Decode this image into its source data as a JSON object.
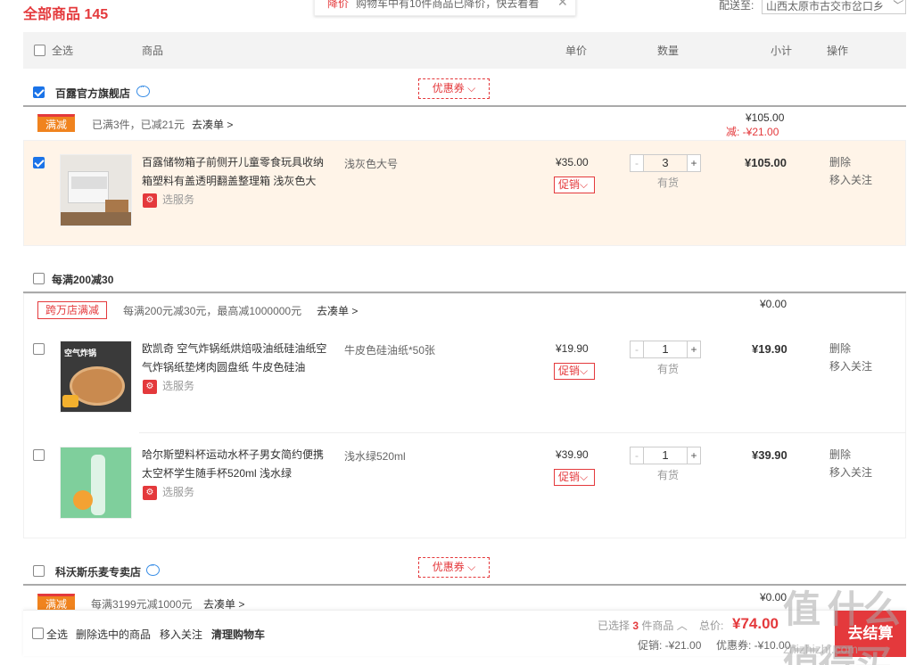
{
  "header": {
    "title": "全部商品",
    "count": "145",
    "toast_tag": "降价",
    "toast_msg": "购物车中有10件商品已降价，快去看看",
    "ship_label": "配送至:",
    "ship_addr": "山西太原市古交市岔口乡"
  },
  "thead": {
    "select_all": "全选",
    "product": "商品",
    "unit_price": "单价",
    "quantity": "数量",
    "subtotal": "小计",
    "action": "操作"
  },
  "shops": [
    {
      "name": "百露官方旗舰店",
      "coupon": "优惠券",
      "promo_tag": "满减",
      "promo_text": "已满3件，已减21元",
      "promo_link": "去凑单 >",
      "sum": "¥105.00",
      "discount": "减: -¥21.00",
      "item": {
        "name": "百露储物箱子前侧开儿童零食玩具收纳箱塑料有盖透明翻盖整理箱 浅灰色大",
        "service": "选服务",
        "attr": "浅灰色大号",
        "price": "¥35.00",
        "promo_btn": "促销",
        "qty": "3",
        "stock": "有货",
        "subtotal": "¥105.00",
        "op_delete": "删除",
        "op_follow": "移入关注"
      }
    },
    {
      "name": "每满200减30",
      "promo_tag": "跨万店满减",
      "promo_text": "每满200元减30元，最高减1000000元",
      "promo_link": "去凑单 >",
      "sum": "¥0.00",
      "items": [
        {
          "name": "欧凯奇 空气炸锅纸烘焙吸油纸硅油纸空气炸锅纸垫烤肉圆盘纸 牛皮色硅油",
          "service": "选服务",
          "attr": "牛皮色硅油纸*50张",
          "price": "¥19.90",
          "promo_btn": "促销",
          "qty": "1",
          "stock": "有货",
          "subtotal": "¥19.90",
          "op_delete": "删除",
          "op_follow": "移入关注",
          "thumb_text": "空气炸锅"
        },
        {
          "name": "哈尔斯塑料杯运动水杯子男女简约便携太空杯学生随手杯520ml 浅水绿",
          "service": "选服务",
          "attr": "浅水绿520ml",
          "price": "¥39.90",
          "promo_btn": "促销",
          "qty": "1",
          "stock": "有货",
          "subtotal": "¥39.90",
          "op_delete": "删除",
          "op_follow": "移入关注"
        }
      ]
    },
    {
      "name": "科沃斯乐麦专卖店",
      "coupon": "优惠券",
      "promo_tag": "满减",
      "promo_text": "每满3199元减1000元",
      "promo_link": "去凑单 >",
      "sum": "¥0.00"
    }
  ],
  "footer": {
    "select_all": "全选",
    "delete_selected": "删除选中的商品",
    "move_follow": "移入关注",
    "clear_cart": "清理购物车",
    "selected_prefix": "已选择",
    "selected_count": "3",
    "selected_suffix": "件商品",
    "total_label": "总价:",
    "total_value": "¥74.00",
    "promo_label": "促销: -¥21.00",
    "coupon_label": "优惠券: -¥10.00",
    "checkout": "去结算"
  },
  "watermark": "值 什么值得买",
  "watermark_url": "zhizhizhi.com",
  "colors": {
    "accent": "#e4393c",
    "selected_row": "#fff4e8",
    "promo_orange": "#f0831e"
  }
}
